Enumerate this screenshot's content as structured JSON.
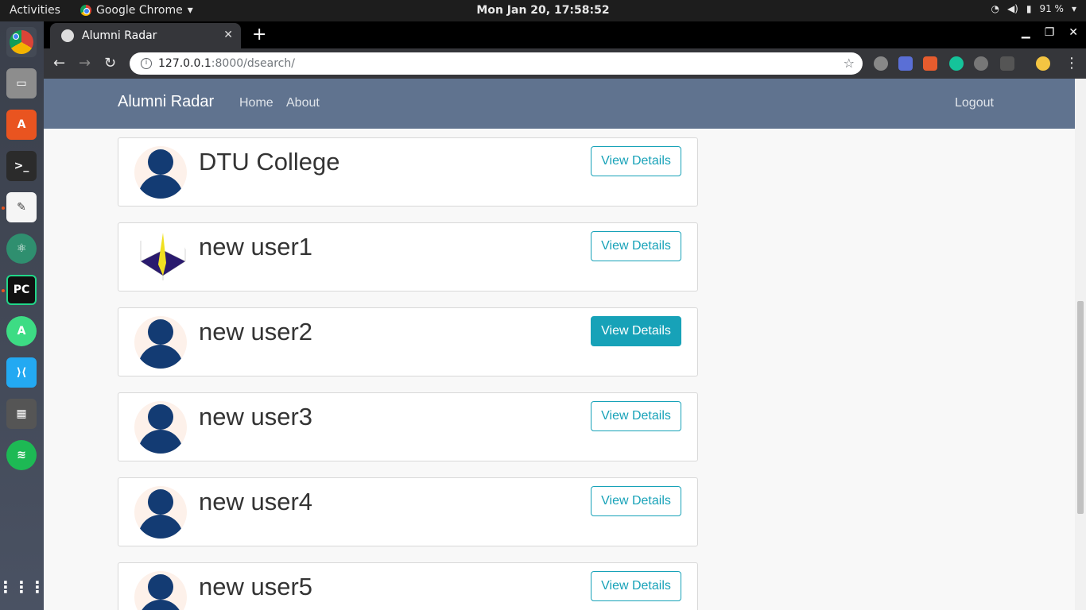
{
  "system_bar": {
    "activities": "Activities",
    "app_name": "Google Chrome",
    "clock": "Mon Jan 20, 17:58:52",
    "battery": "91 %"
  },
  "browser": {
    "tab_title": "Alumni Radar",
    "url_host": "127.0.0.1",
    "url_path": ":8000/dsearch/"
  },
  "site": {
    "brand": "Alumni Radar",
    "nav": [
      "Home",
      "About"
    ],
    "logout": "Logout"
  },
  "results": [
    {
      "name": "DTU College",
      "button": "View Details",
      "avatar": "default-avatar",
      "active": false
    },
    {
      "name": "new user1",
      "button": "View Details",
      "avatar": "plot-image",
      "active": false
    },
    {
      "name": "new user2",
      "button": "View Details",
      "avatar": "default-avatar",
      "active": true
    },
    {
      "name": "new user3",
      "button": "View Details",
      "avatar": "default-avatar",
      "active": false
    },
    {
      "name": "new user4",
      "button": "View Details",
      "avatar": "default-avatar",
      "active": false
    },
    {
      "name": "new user5",
      "button": "View Details",
      "avatar": "default-avatar",
      "active": false
    }
  ],
  "colors": {
    "navbar": "#60738f",
    "accent": "#17a2b8",
    "avatar": "#133b73"
  }
}
